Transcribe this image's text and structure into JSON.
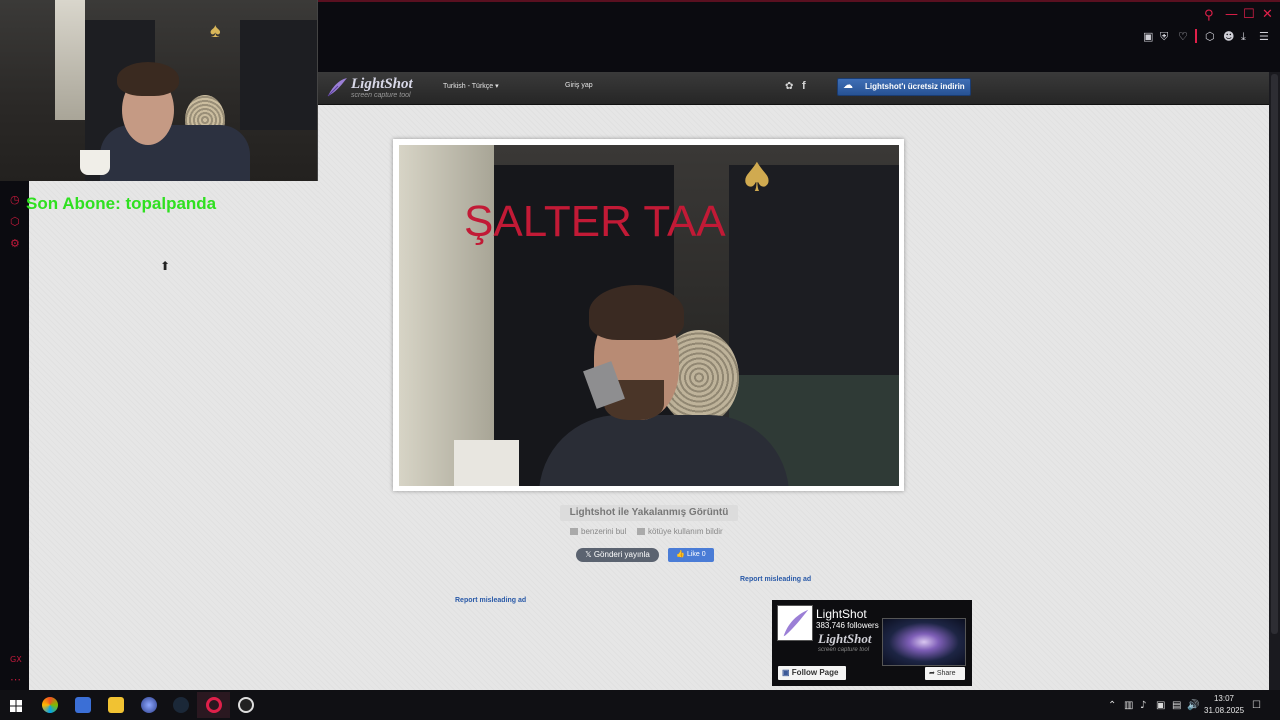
{
  "browser": {
    "window_controls": [
      "search",
      "minimize",
      "maximize",
      "close"
    ],
    "toolbar_icons": [
      "snapshot-icon",
      "shield-icon",
      "heart-icon",
      "extensions-icon",
      "account-icon",
      "download-icon",
      "menu-icon"
    ],
    "accent_color": "#e0204a"
  },
  "overlay": {
    "subscriber_text": "Son Abone: topalpanda",
    "subscriber_color": "#2fe020",
    "sidebar_label": "GX"
  },
  "lightshot": {
    "logo_text": "LightShot",
    "logo_subtitle": "screen capture tool",
    "language": "Turkish - Türkçe",
    "login": "Giriş yap",
    "download_button": "Lightshot'ı ücretsiz indirin",
    "image_caption": "ŞALTER TAA",
    "image_title": "Lightshot ile Yakalanmış Görüntü",
    "find_similar": "benzerini bul",
    "report_abuse": "kötüye kullanım bildir",
    "tweet_button": "Gönderi yayınla",
    "like_button": "Like 0",
    "report_ad_1": "Report misleading ad",
    "report_ad_2": "Report misleading ad"
  },
  "facebook_widget": {
    "page_name": "LightShot",
    "followers": "383,746 followers",
    "watermark": "LightShot",
    "watermark_sub": "screen capture tool",
    "follow_button": "Follow Page",
    "share_button": "Share"
  },
  "taskbar": {
    "time": "13:07",
    "date": "31.08.2025"
  }
}
